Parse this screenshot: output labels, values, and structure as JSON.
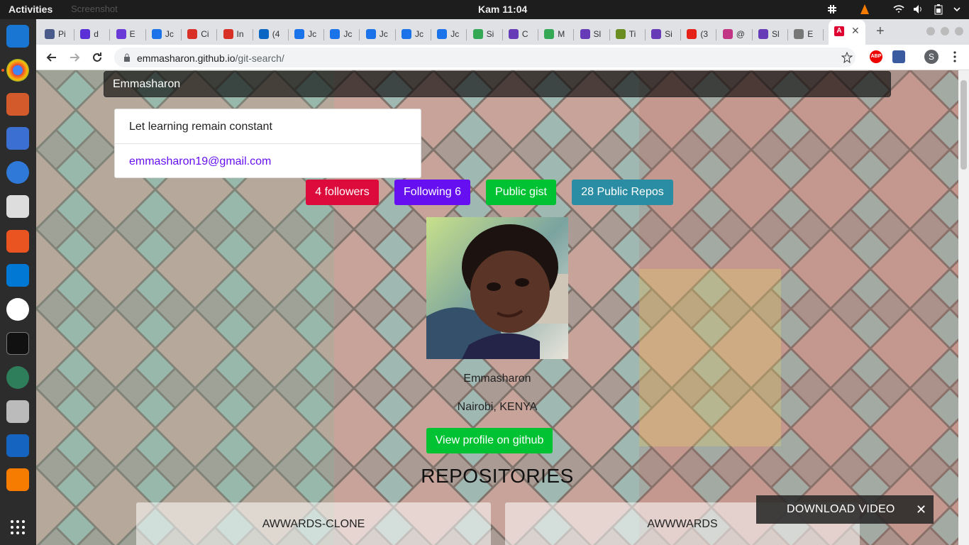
{
  "system": {
    "activities": "Activities",
    "app_menu": "Screenshot",
    "clock": "Kam 11:04"
  },
  "browser": {
    "tabs": [
      {
        "label": "Pi",
        "color": "#4a5a8a"
      },
      {
        "label": "d",
        "color": "#5b2fd6"
      },
      {
        "label": "E",
        "color": "#6a3ad8"
      },
      {
        "label": "Jc",
        "color": "#1a73e8"
      },
      {
        "label": "Ci",
        "color": "#d93025"
      },
      {
        "label": "In",
        "color": "#d93025"
      },
      {
        "label": "(4",
        "color": "#0a66c2"
      },
      {
        "label": "Jc",
        "color": "#1a73e8"
      },
      {
        "label": "Jc",
        "color": "#1a73e8"
      },
      {
        "label": "Jc",
        "color": "#1a73e8"
      },
      {
        "label": "Jc",
        "color": "#1a73e8"
      },
      {
        "label": "Jc",
        "color": "#1a73e8"
      },
      {
        "label": "Si",
        "color": "#34a853"
      },
      {
        "label": "C",
        "color": "#673ab7"
      },
      {
        "label": "M",
        "color": "#34a853"
      },
      {
        "label": "Sl",
        "color": "#673ab7"
      },
      {
        "label": "Ti",
        "color": "#6b8e23"
      },
      {
        "label": "Si",
        "color": "#673ab7"
      },
      {
        "label": "(3",
        "color": "#e62117"
      },
      {
        "label": "@",
        "color": "#c13584"
      },
      {
        "label": "Sl",
        "color": "#673ab7"
      },
      {
        "label": "E",
        "color": "#777"
      }
    ],
    "active_tab": {
      "label": "A",
      "color": "#dd0031"
    },
    "url_host": "emmasharon.github.io",
    "url_path": "/git-search/",
    "profile_letter": "S"
  },
  "page": {
    "search_value": "Emmasharon",
    "bio": "Let learning remain constant",
    "email": "emmasharon19@gmail.com",
    "stats": {
      "followers": "4 followers",
      "following": "Following 6",
      "gist": "Public gist",
      "repos": "28 Public Repos"
    },
    "colors": {
      "followers": "#dc0b3c",
      "following": "#6610f2",
      "gist": "#00c233",
      "repos": "#2a8da3"
    },
    "username": "Emmasharon",
    "location": "Nairobi, KENYA",
    "profile_button": "View profile on github",
    "repositories_heading": "REPOSITORIES",
    "repos": [
      "AWWARDS-CLONE",
      "AWWWARDS"
    ],
    "download_overlay": "DOWNLOAD VIDEO",
    "close_glyph": "✕"
  }
}
